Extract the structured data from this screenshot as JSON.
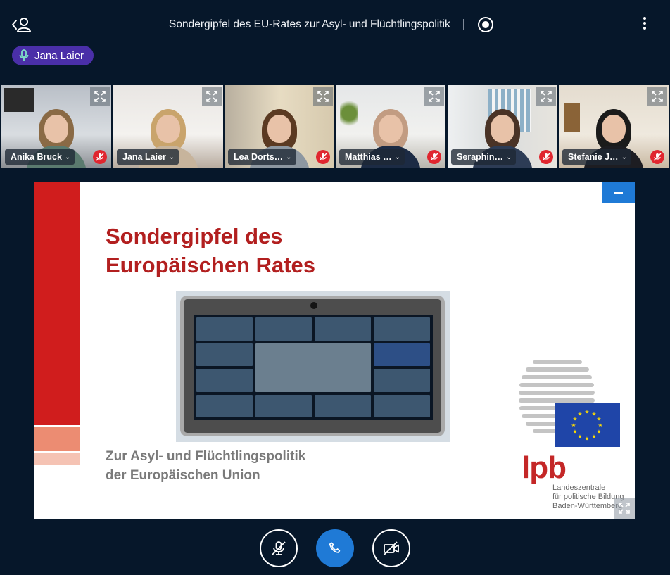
{
  "header": {
    "title": "Sondergipfel des EU-Rates zur Asyl- und Flüchtlingspolitik",
    "users_icon": "users-toggle-icon",
    "recording_icon": "record-icon",
    "menu_icon": "more-options-icon"
  },
  "talking_indicator": {
    "name": "Jana Laier",
    "icon": "microphone-icon"
  },
  "participants": [
    {
      "name": "Anika Bruck",
      "muted": true
    },
    {
      "name": "Jana Laier",
      "muted": false,
      "active": true
    },
    {
      "name": "Lea Dorts…",
      "muted": true
    },
    {
      "name": "Matthias …",
      "muted": true
    },
    {
      "name": "Seraphin…",
      "muted": true
    },
    {
      "name": "Stefanie J…",
      "muted": true
    }
  ],
  "slide": {
    "title_line1": "Sondergipfel des",
    "title_line2": "Europäischen Rates",
    "subtitle_line1": "Zur Asyl- und Flüchtlingspolitik",
    "subtitle_line2": "der Europäischen Union",
    "logo_text": "lpb",
    "logo_sub_line1": "Landeszentrale",
    "logo_sub_line2": "für politische Bildung",
    "logo_sub_line3": "Baden-Württemberg"
  },
  "controls": {
    "mute_icon": "microphone-muted-icon",
    "leave_icon": "phone-icon",
    "video_icon": "video-off-icon"
  },
  "colors": {
    "background": "#06172a",
    "accent_blue": "#1f7ad6",
    "talking_pill": "#4a2fa8",
    "mute_red": "#e0262f",
    "slide_red": "#b21f1f"
  }
}
